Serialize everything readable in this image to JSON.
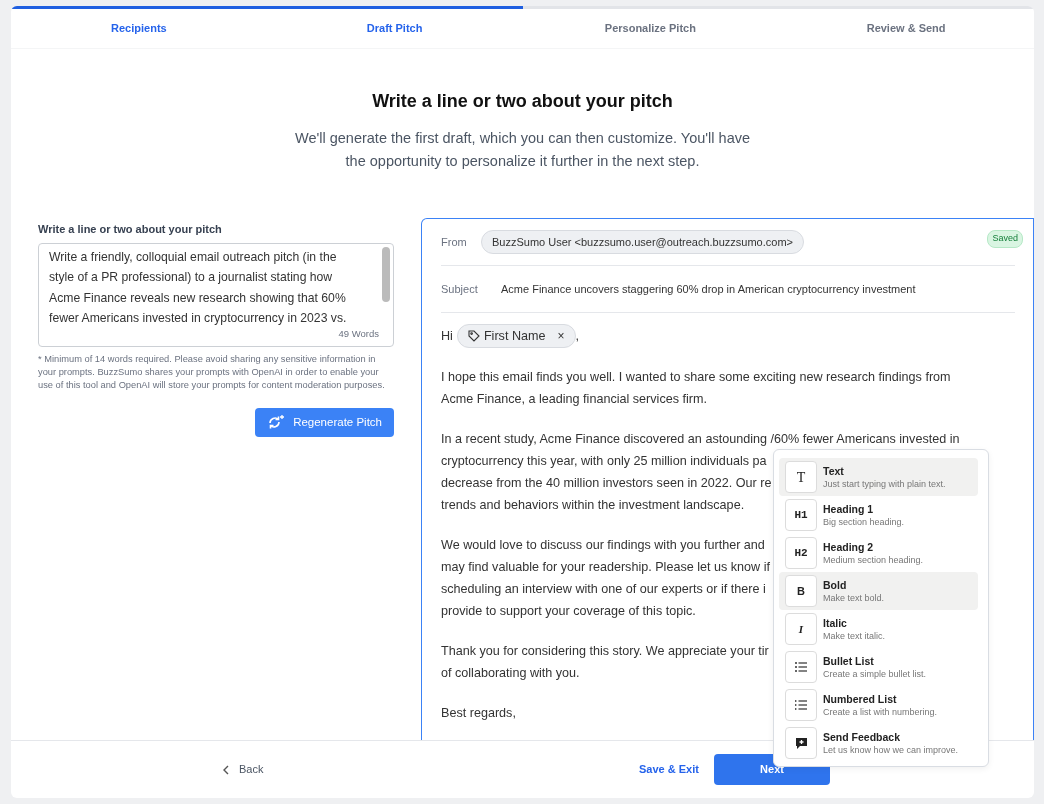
{
  "progress": {
    "level": 0.5
  },
  "steps": [
    {
      "label": "Recipients",
      "reached": true
    },
    {
      "label": "Draft Pitch",
      "reached": true
    },
    {
      "label": "Personalize Pitch",
      "reached": false
    },
    {
      "label": "Review & Send",
      "reached": false
    }
  ],
  "heading": "Write a line or two about your pitch",
  "subheading": [
    "We'll generate the first draft, which you can then customize. You'll have",
    "the opportunity to personalize it further in the next step."
  ],
  "pitch": {
    "label": "Write a line or two about your pitch",
    "lines": [
      "Write a friendly, colloquial email outreach pitch (in the",
      "style of a PR professional) to a journalist stating how",
      "Acme Finance reveals new research showing that 60%",
      "fewer Americans invested in cryptocurrency in 2023 vs."
    ],
    "word_count": "49 Words",
    "note": "* Minimum of 14 words required. Please avoid sharing any sensitive information in your prompts. BuzzSumo shares your prompts with OpenAI in order to enable your use of this tool and OpenAI will store your prompts for content moderation purposes.",
    "button": "Regenerate Pitch"
  },
  "email": {
    "from_label": "From",
    "from": "BuzzSumo User <buzzsumo.user@outreach.buzzsumo.com>",
    "status": "Saved",
    "subject_label": "Subject",
    "subject": "Acme Finance uncovers staggering 60% drop in American cryptocurrency investment",
    "greeting": "Hi",
    "merge_tag": "First Name",
    "merge_tag_remove": "×",
    "greeting_end": ",",
    "paragraphs": [
      [
        "I hope this email finds you well. I wanted to share some exciting new research findings from",
        "Acme Finance, a leading financial services firm."
      ],
      [
        "In a recent study, Acme Finance discovered an astounding /60% fewer Americans invested in",
        "cryptocurrency this year, with only 25 million individuals pa",
        "decrease from the 40 million investors seen in 2022. Our re",
        "trends and behaviors within the investment landscape."
      ],
      [
        "We would love to discuss our findings with you further and",
        "may find valuable for your readership. Please let us know if",
        "scheduling an interview with one of our experts or if there i",
        "provide to support your coverage of this topic."
      ],
      [
        "Thank you for considering this story. We appreciate your tir",
        "of collaborating with you."
      ],
      [
        "Best regards,"
      ]
    ]
  },
  "menu": [
    {
      "kind": "text",
      "glyph": "T",
      "title": "Text",
      "description": "Just start typing with plain text.",
      "highlighted": true
    },
    {
      "kind": "h1",
      "glyph": "H1",
      "title": "Heading 1",
      "description": "Big section heading.",
      "highlighted": false
    },
    {
      "kind": "h2",
      "glyph": "H2",
      "title": "Heading 2",
      "description": "Medium section heading.",
      "highlighted": false
    },
    {
      "kind": "bold",
      "glyph": "B",
      "title": "Bold",
      "description": "Make text bold.",
      "highlighted": true
    },
    {
      "kind": "italic",
      "glyph": "I",
      "title": "Italic",
      "description": "Make text italic.",
      "highlighted": false
    },
    {
      "kind": "bullet",
      "title": "Bullet List",
      "description": "Create a simple bullet list.",
      "highlighted": false
    },
    {
      "kind": "numbered",
      "title": "Numbered List",
      "description": "Create a list with numbering.",
      "highlighted": false
    },
    {
      "kind": "feedback",
      "title": "Send Feedback",
      "description": "Let us know how we can improve.",
      "highlighted": false
    }
  ],
  "footer": {
    "back": "Back",
    "save": "Save & Exit",
    "next": "Next"
  }
}
